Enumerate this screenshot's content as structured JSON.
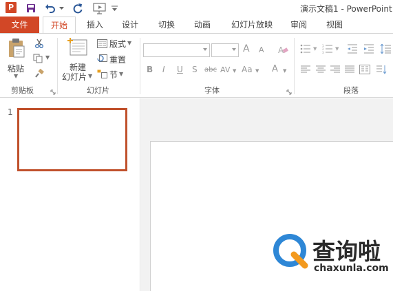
{
  "window": {
    "title": "演示文稿1 - PowerPoint",
    "app_icon_letter": "P"
  },
  "quick_access": {
    "icons": [
      "powerpoint-app-icon",
      "save-icon",
      "undo-icon",
      "dropdown-icon",
      "redo-icon",
      "start-slideshow-icon",
      "customize-quick-access-icon"
    ]
  },
  "tabs": [
    {
      "label": "文件",
      "key": "file"
    },
    {
      "label": "开始",
      "key": "home",
      "selected": true
    },
    {
      "label": "插入",
      "key": "insert"
    },
    {
      "label": "设计",
      "key": "design"
    },
    {
      "label": "切换",
      "key": "transitions"
    },
    {
      "label": "动画",
      "key": "animations"
    },
    {
      "label": "幻灯片放映",
      "key": "slideshow"
    },
    {
      "label": "审阅",
      "key": "review"
    },
    {
      "label": "视图",
      "key": "view"
    }
  ],
  "ribbon": {
    "clipboard": {
      "group_label": "剪贴板",
      "paste_label": "粘贴",
      "icons": [
        "clipboard-icon",
        "cut-icon",
        "copy-icon",
        "format-painter-icon"
      ]
    },
    "slides": {
      "group_label": "幻灯片",
      "new_slide_label_1": "新建",
      "new_slide_label_2": "幻灯片",
      "layout_label": "版式",
      "reset_label": "重置",
      "section_label": "节"
    },
    "font": {
      "group_label": "字体",
      "font_name_value": "",
      "font_size_value": "",
      "format_icons": [
        "bold-icon",
        "italic-icon",
        "underline-icon",
        "shadow-icon",
        "strikethrough-icon",
        "character-spacing-icon",
        "change-case-icon",
        "font-color-icon",
        "increase-font-icon",
        "decrease-font-icon",
        "clear-formatting-icon"
      ],
      "bold": "B",
      "italic": "I",
      "underline": "U",
      "shadow": "S",
      "strikethrough": "abc",
      "char_spacing": "AV",
      "change_case": "Aa",
      "font_color": "A",
      "grow": "A",
      "shrink": "A"
    },
    "paragraph": {
      "group_label": "段落",
      "icons": [
        "bullets-icon",
        "numbering-icon",
        "decrease-indent-icon",
        "increase-indent-icon",
        "line-spacing-icon",
        "align-left-icon",
        "align-center-icon",
        "align-right-icon",
        "justify-icon",
        "columns-icon"
      ]
    }
  },
  "thumbnails": [
    {
      "number": "1",
      "selected": true
    }
  ],
  "watermark": {
    "title": "查询啦",
    "url": "chaxunla.com"
  },
  "colors": {
    "accent": "#d24726",
    "thumb_border": "#c0512c",
    "watermark_blue": "#2e87d6",
    "watermark_orange": "#f39a1e"
  }
}
